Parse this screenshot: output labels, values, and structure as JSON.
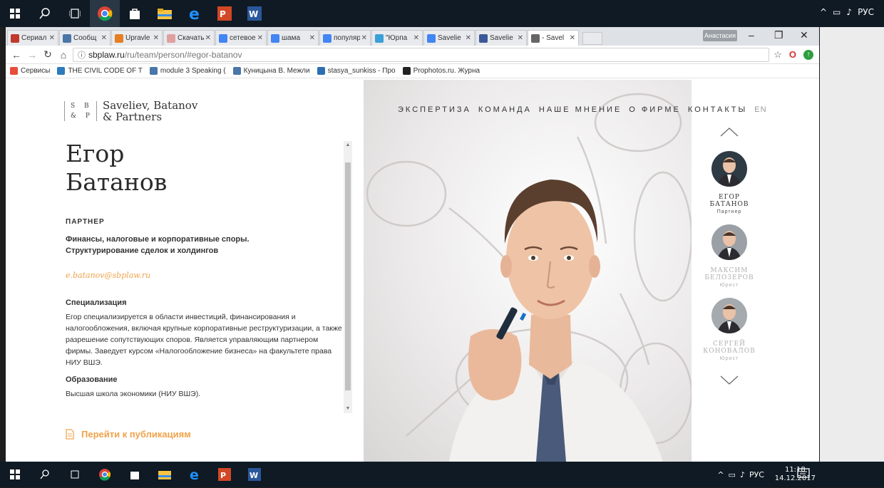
{
  "os": {
    "tray_lang": "РУС",
    "clock_time": "11:18",
    "clock_date": "14.12.2017"
  },
  "browser": {
    "tabs": [
      {
        "label": "Сериал",
        "color": "#c0392b"
      },
      {
        "label": "Сообщ",
        "color": "#4a76a8"
      },
      {
        "label": "Upravle",
        "color": "#e67e22"
      },
      {
        "label": "Скачать",
        "color": "#e0a0a0"
      },
      {
        "label": "сетевое",
        "color": "#4285f4"
      },
      {
        "label": "шама",
        "color": "#4285f4"
      },
      {
        "label": "популяр",
        "color": "#4285f4"
      },
      {
        "label": "\"Юрпа",
        "color": "#3aa0d8"
      },
      {
        "label": "Savelie",
        "color": "#4285f4"
      },
      {
        "label": "Savelie",
        "color": "#3b5998"
      },
      {
        "label": "- Savel",
        "color": "#666666"
      }
    ],
    "profile_name": "Анастасия",
    "url_host": "sbplaw.ru",
    "url_path": "/ru/team/person/#egor-batanov",
    "bookmarks": [
      {
        "label": "Сервисы",
        "color": "#e74c3c"
      },
      {
        "label": "THE CIVIL CODE OF T",
        "color": "#2c7bbd"
      },
      {
        "label": "module 3 Speaking (",
        "color": "#4a76a8"
      },
      {
        "label": "Куницына В. Межли",
        "color": "#4a76a8"
      },
      {
        "label": "stasya_sunkiss - Про",
        "color": "#2c6fb0"
      },
      {
        "label": "Prophotos.ru. Журна",
        "color": "#222222"
      }
    ]
  },
  "site": {
    "logo_letters_1": "S B",
    "logo_letters_2": "& P",
    "logo_line1": "Saveliev, Batanov",
    "logo_line2": "& Partners",
    "nav": [
      "ЭКСПЕРТИЗА",
      "КОМАНДА",
      "НАШЕ МНЕНИЕ",
      "О ФИРМЕ",
      "КОНТАКТЫ"
    ],
    "lang": "EN",
    "person": {
      "first_name": "Егор",
      "last_name": "Батанов",
      "role": "ПАРТНЕР",
      "practice_1": "Финансы, налоговые и корпоративные споры.",
      "practice_2": "Структурирование сделок и холдингов",
      "email": "e.batanov@sbplaw.ru",
      "spec_title": "Специализация",
      "spec_text": "Егор специализируется в области инвестиций, финансирования и налогообложения, включая крупные корпоративные реструктуризации, а также разрешение сопутствующих споров. Является управляющим партнером фирмы. Заведует курсом «Налогообложение бизнеса» на факультете права НИУ ВШЭ.",
      "edu_title": "Образование",
      "edu_text": "Высшая школа экономики (НИУ ВШЭ)."
    },
    "publications_link": "Перейти к публикациям",
    "team": [
      {
        "line1": "ЕГОР",
        "line2": "БАТАНОВ",
        "role": "Партнер"
      },
      {
        "line1": "МАКСИМ",
        "line2": "БЕЛОЗЕРОВ",
        "role": "Юрист"
      },
      {
        "line1": "СЕРГЕЙ",
        "line2": "КОНОВАЛОВ",
        "role": "Юрист"
      }
    ]
  }
}
